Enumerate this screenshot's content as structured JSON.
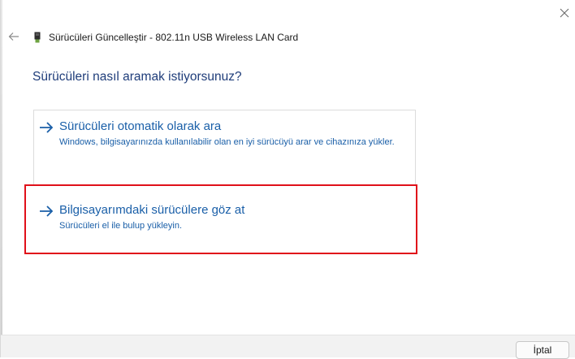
{
  "window": {
    "title": "Sürücüleri Güncelleştir - 802.11n USB Wireless LAN Card",
    "device_icon": "usb-device-icon",
    "back_icon": "back-arrow-icon",
    "close_icon": "close-icon"
  },
  "main": {
    "heading": "Sürücüleri nasıl aramak istiyorsunuz?",
    "options": [
      {
        "title": "Sürücüleri otomatik olarak ara",
        "description": "Windows, bilgisayarınızda kullanılabilir olan en iyi sürücüyü arar ve cihazınıza yükler.",
        "icon": "arrow-right-icon"
      },
      {
        "title": "Bilgisayarımdaki sürücülere göz at",
        "description": "Sürücüleri el ile bulup yükleyin.",
        "icon": "arrow-right-icon"
      }
    ],
    "highlight_color": "#e0101a",
    "link_color": "#1a5fa8"
  },
  "footer": {
    "cancel_label": "İptal"
  }
}
